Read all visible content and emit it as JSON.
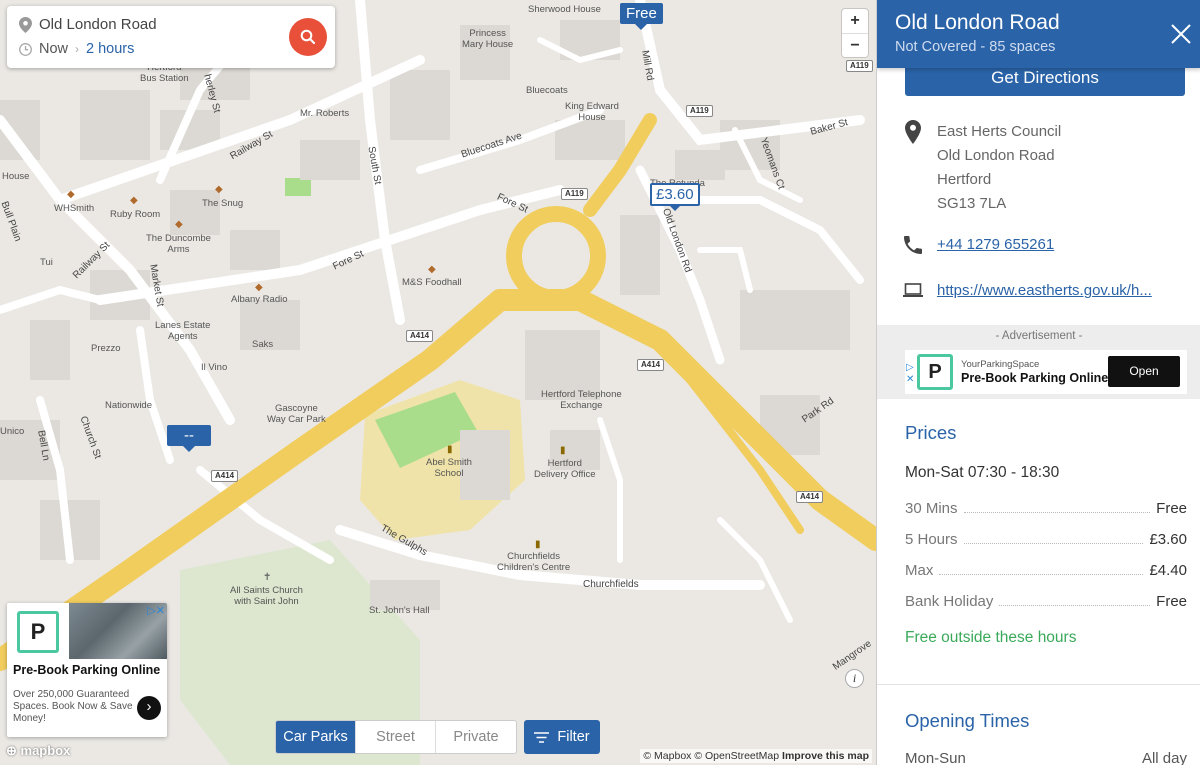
{
  "search": {
    "location": "Old London Road",
    "time_from": "Now",
    "duration": "2 hours"
  },
  "map": {
    "zoom_in": "+",
    "zoom_out": "−",
    "markers": {
      "free": "Free",
      "price": "£3.60",
      "unknown": "--"
    },
    "places": {
      "sherwood": "Sherwood House",
      "princess": "Princess\nMary House",
      "bus": "Hertford\nBus Station",
      "roberts": "Mr. Roberts",
      "bluecoats": "Bluecoats",
      "kingedward": "King Edward\nHouse",
      "house": "House",
      "whsmith": "WHSmith",
      "ruby": "Ruby Room",
      "snug": "The Snug",
      "duncombe": "The Duncombe\nArms",
      "tui": "Tui",
      "mands": "M&S Foodhall",
      "albany": "Albany Radio",
      "rotunda": "The Rotunda",
      "lanes": "Lanes Estate\nAgents",
      "prezzo": "Prezzo",
      "saks": "Saks",
      "ilvino": "Il Vino",
      "nationwide": "Nationwide",
      "gascoyne": "Gascoyne\nWay Car Park",
      "unico": "Unico",
      "telephone": "Hertford Telephone\nExchange",
      "abel": "Abel Smith\nSchool",
      "delivery": "Hertford\nDelivery Office",
      "churchfields_cc": "Churchfields\nChildren's Centre",
      "allsaints": "All Saints Church\nwith Saint John",
      "stjohns": "St. John's Hall"
    },
    "streets": {
      "railway": "Railway St",
      "south": "South St",
      "bluecoats_ave": "Bluecoats Ave",
      "fore1": "Fore St",
      "fore2": "Fore St",
      "mill": "Mill Rd",
      "baker": "Baker St",
      "yeomans": "Yeomans Ct",
      "oldlondon": "Old London Rd",
      "bullplain": "Bull Plain",
      "railway2": "Railway St",
      "market": "Market St",
      "church": "Church St",
      "bell": "Bell Ln",
      "gulphs": "The Gulphs",
      "churchfields": "Churchfields",
      "park": "Park Rd",
      "mangrove": "Mangrove",
      "herley": "herley St"
    },
    "shields": {
      "a119_top": "A119",
      "a119_mid": "A119",
      "a119_fore": "A119",
      "a414_left": "A414",
      "a414_mid": "A414",
      "a414_right": "A414",
      "a414_far": "A414"
    },
    "tabs": [
      "Car Parks",
      "Street",
      "Private"
    ],
    "active_tab": "Car Parks",
    "filter_label": "Filter",
    "attribution": "© Mapbox © OpenStreetMap",
    "improve": "Improve this map",
    "mapbox": "mapbox",
    "info": "i"
  },
  "map_ad": {
    "logo": "P",
    "title": "Pre-Book Parking Online",
    "desc": "Over 250,000 Guaranteed Spaces. Book Now & Save Money!"
  },
  "panel": {
    "name": "Old London Road",
    "subtitle": "Not Covered - 85 spaces",
    "directions": "Get Directions",
    "address": [
      "East Herts Council",
      "Old London Road",
      "Hertford",
      "SG13 7LA"
    ],
    "phone": "+44 1279 655261",
    "website": "https://www.eastherts.gov.uk/h...",
    "ad_label": "- Advertisement -",
    "ad_brand": "YourParkingSpace",
    "ad_title": "Pre-Book Parking Online",
    "ad_open": "Open",
    "ad_logo": "P",
    "prices_title": "Prices",
    "price_period": "Mon-Sat 07:30 - 18:30",
    "prices": [
      {
        "label": "30 Mins",
        "value": "Free"
      },
      {
        "label": "5 Hours",
        "value": "£3.60"
      },
      {
        "label": "Max",
        "value": "£4.40"
      },
      {
        "label": "Bank Holiday",
        "value": "Free"
      }
    ],
    "free_note": "Free outside these hours",
    "opening_title": "Opening Times",
    "opening_day": "Mon-Sun",
    "opening_value": "All day"
  },
  "colors": {
    "brand": "#2a63a8",
    "search_button": "#e8503a",
    "road_major": "#f1cd5e",
    "free_text": "#3aa95a"
  }
}
